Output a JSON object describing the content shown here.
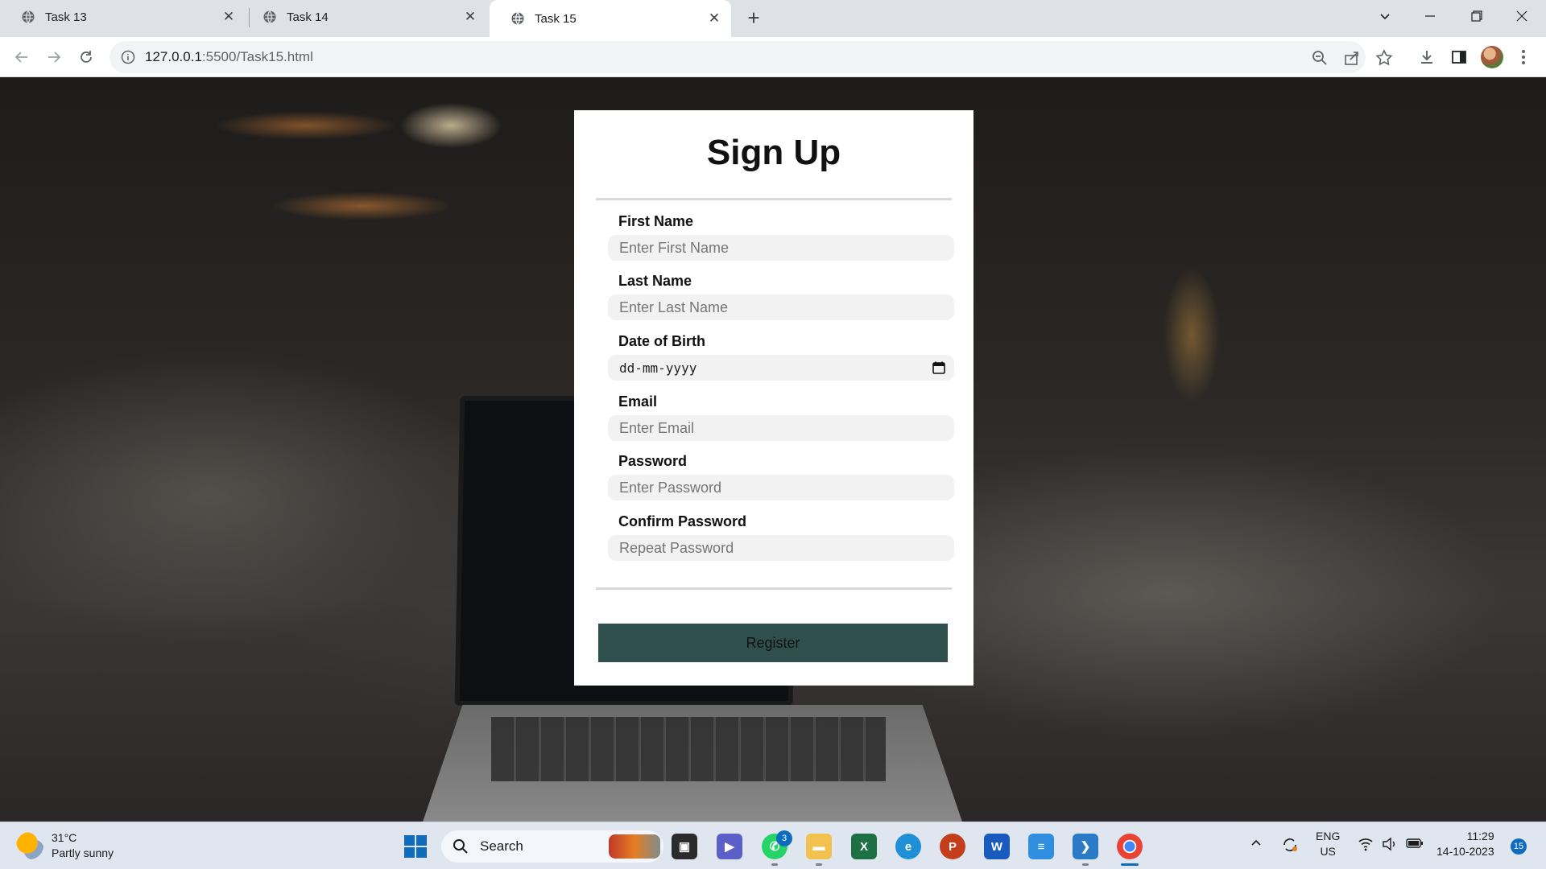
{
  "browser": {
    "tabs": [
      {
        "title": "Task 13",
        "active": false
      },
      {
        "title": "Task 14",
        "active": false
      },
      {
        "title": "Task 15",
        "active": true
      }
    ],
    "new_tab_label": "+",
    "url_host": "127.0.0.1",
    "url_path": ":5500/Task15.html",
    "icons": [
      "back-icon",
      "forward-icon",
      "reload-icon",
      "info-icon",
      "zoom-icon",
      "share-icon",
      "star-icon",
      "download-icon",
      "sidepanel-icon",
      "avatar",
      "menu-icon"
    ]
  },
  "form": {
    "title": "Sign Up",
    "fields": [
      {
        "label": "First Name",
        "placeholder": "Enter First Name"
      },
      {
        "label": "Last Name",
        "placeholder": "Enter Last Name"
      },
      {
        "label": "Date of Birth",
        "placeholder": "dd-mm-yyyy"
      },
      {
        "label": "Email",
        "placeholder": "Enter Email"
      },
      {
        "label": "Password",
        "placeholder": "Enter Password"
      },
      {
        "label": "Confirm Password",
        "placeholder": "Repeat Password"
      }
    ],
    "submit_label": "Register",
    "submit_color": "#2f4f4f"
  },
  "taskbar": {
    "weather_temp": "31°C",
    "weather_desc": "Partly sunny",
    "search_label": "Search",
    "whatsapp_badge": "3",
    "lang": "ENG",
    "region": "US",
    "time": "11:29",
    "date": "14-10-2023",
    "notifications": "15",
    "accent": "#0f6cbd"
  }
}
